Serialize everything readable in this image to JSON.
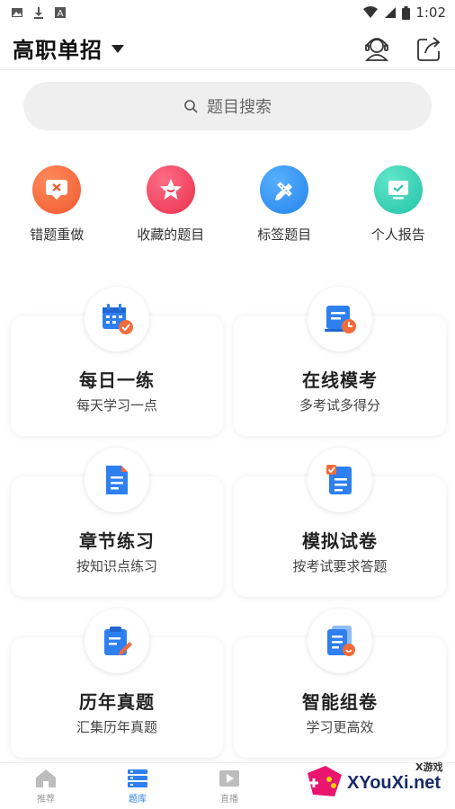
{
  "status_bar": {
    "time": "1:02"
  },
  "header": {
    "title": "高职单招"
  },
  "search": {
    "placeholder": "题目搜索"
  },
  "quick_actions": [
    {
      "label": "错题重做",
      "icon": "wrong-answer-icon",
      "color": "#f26b3a"
    },
    {
      "label": "收藏的题目",
      "icon": "star-icon",
      "color": "#ee3e5a"
    },
    {
      "label": "标签题目",
      "icon": "pencil-ruler-icon",
      "color": "#2e8ef0"
    },
    {
      "label": "个人报告",
      "icon": "report-monitor-icon",
      "color": "#2fcfb0"
    }
  ],
  "cards": [
    {
      "title": "每日一练",
      "subtitle": "每天学习一点",
      "icon": "calendar-check-icon"
    },
    {
      "title": "在线模考",
      "subtitle": "多考试多得分",
      "icon": "exam-clock-icon"
    },
    {
      "title": "章节练习",
      "subtitle": "按知识点练习",
      "icon": "document-icon"
    },
    {
      "title": "模拟试卷",
      "subtitle": "按考试要求答题",
      "icon": "checklist-paper-icon"
    },
    {
      "title": "历年真题",
      "subtitle": "汇集历年真题",
      "icon": "clipboard-edit-icon"
    },
    {
      "title": "智能组卷",
      "subtitle": "学习更高效",
      "icon": "smart-paper-icon"
    }
  ],
  "tabs": [
    {
      "label": "推荐",
      "icon": "home-icon",
      "active": false
    },
    {
      "label": "题库",
      "icon": "question-bank-icon",
      "active": true
    },
    {
      "label": "直播",
      "icon": "play-video-icon",
      "active": false
    }
  ],
  "watermark": {
    "brand": "XYouXi.net",
    "tag": "X游戏"
  },
  "colors": {
    "accent": "#2e7ff0",
    "card_blue": "#2e7ff0",
    "badge_orange": "#f26b3a"
  }
}
